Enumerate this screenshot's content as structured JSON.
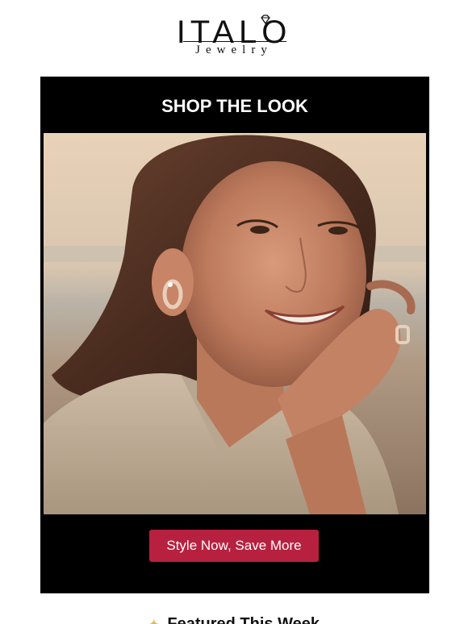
{
  "brand": {
    "name": "ITALO",
    "tagline": "Jewelry"
  },
  "promo": {
    "title": "SHOP THE LOOK",
    "cta_label": "Style Now, Save More",
    "cta_color": "#b8203f",
    "image_alt": "Smiling woman wearing gold earrings and ring on a beach at sunset"
  },
  "featured": {
    "icon": "sparkle-icon",
    "title": "Featured This Week"
  }
}
